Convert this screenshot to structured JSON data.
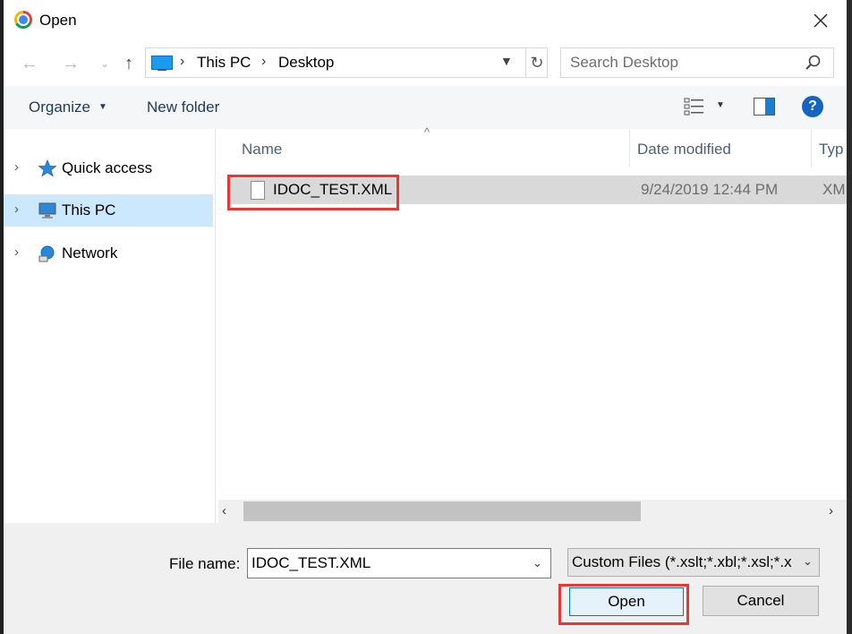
{
  "window": {
    "title": "Open",
    "close_icon": "close-icon",
    "app_icon": "chrome-icon"
  },
  "address_bar": {
    "location_icon": "this-pc-icon",
    "breadcrumbs": [
      "This PC",
      "Desktop"
    ],
    "separator": "›"
  },
  "search": {
    "placeholder": "Search Desktop",
    "icon": "search-icon"
  },
  "command_bar": {
    "organize_label": "Organize",
    "new_folder_label": "New folder",
    "help_label": "?"
  },
  "nav_pane": {
    "items": [
      {
        "label": "Quick access",
        "icon": "star-icon"
      },
      {
        "label": "This PC",
        "icon": "computer-icon",
        "selected": true
      },
      {
        "label": "Network",
        "icon": "network-icon"
      }
    ]
  },
  "file_list": {
    "columns": [
      "Name",
      "Date modified",
      "Typ"
    ],
    "rows": [
      {
        "name": "IDOC_TEST.XML",
        "date_modified": "9/24/2019 12:44 PM",
        "type": "XM",
        "selected": true
      }
    ]
  },
  "footer": {
    "file_name_label": "File name:",
    "file_name_value": "IDOC_TEST.XML",
    "file_type_value": "Custom Files (*.xslt;*.xbl;*.xsl;*.x",
    "open_label": "Open",
    "cancel_label": "Cancel"
  },
  "highlight_color": "#e53935",
  "selection_color": "#cce8ff"
}
